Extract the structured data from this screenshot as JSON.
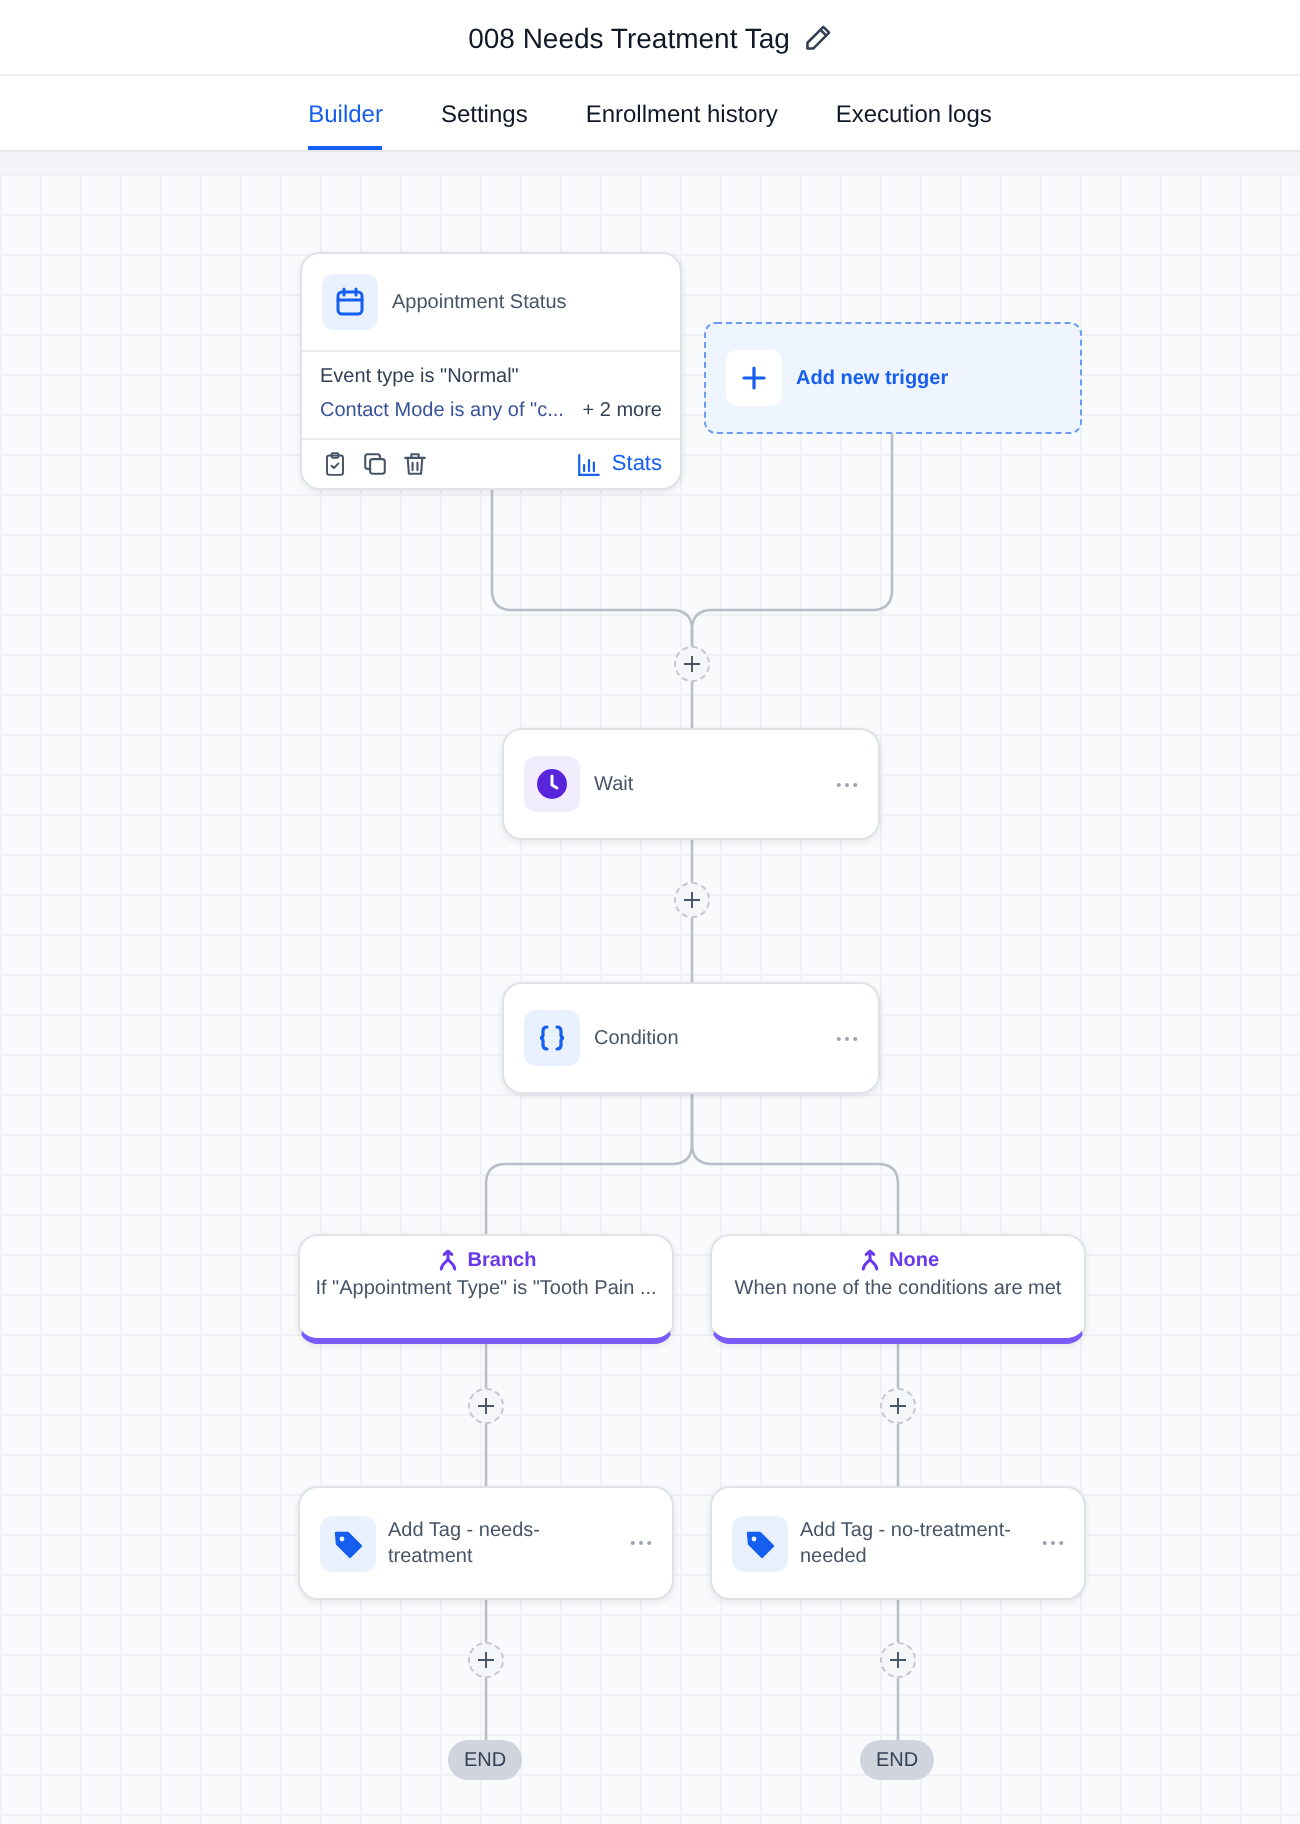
{
  "header": {
    "title": "008 Needs Treatment Tag"
  },
  "tabs": [
    {
      "label": "Builder",
      "selected": true
    },
    {
      "label": "Settings",
      "selected": false
    },
    {
      "label": "Enrollment history",
      "selected": false
    },
    {
      "label": "Execution logs",
      "selected": false
    }
  ],
  "trigger": {
    "title": "Appointment Status",
    "filters": [
      "Event type is \"Normal\"",
      "Contact Mode is any of \"c..."
    ],
    "more": "+ 2 more",
    "stats": "Stats"
  },
  "add_trigger": {
    "label": "Add new trigger"
  },
  "steps": [
    {
      "kind": "wait",
      "title": "Wait"
    },
    {
      "kind": "condition",
      "title": "Condition"
    }
  ],
  "branches": [
    {
      "title": "Branch",
      "description": "If \"Appointment Type\" is \"Tooth Pain ...",
      "action": {
        "kind": "tag",
        "title": "Add Tag - needs-treatment"
      },
      "end": "END"
    },
    {
      "title": "None",
      "description": "When none of the conditions are met",
      "action": {
        "kind": "tag",
        "title": "Add Tag - no-treatment-needed"
      },
      "end": "END"
    }
  ]
}
